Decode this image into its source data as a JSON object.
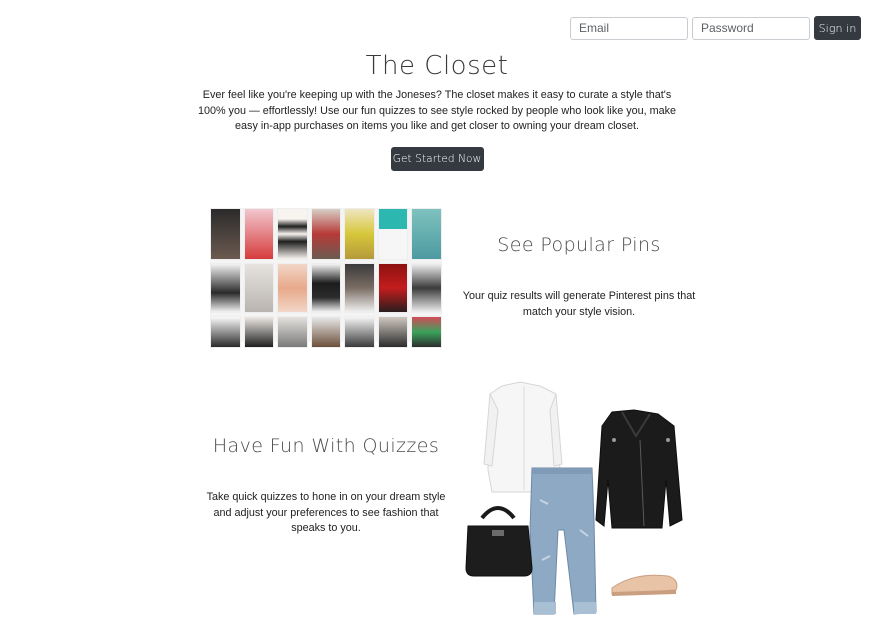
{
  "signin": {
    "email_placeholder": "Email",
    "password_placeholder": "Password",
    "button_label": "Sign in"
  },
  "hero": {
    "title": "The Closet",
    "intro": "Ever feel like you're keeping up with the Joneses? The closet makes it easy to curate a style that's 100% you — effortlessly! Use our fun quizzes to see style rocked by people who look like you, make easy in-app purchases on items you like and get closer to owning your dream closet.",
    "cta_label": "Get Started Now"
  },
  "pins": {
    "heading": "See Popular Pins",
    "text": "Your quiz results will generate Pinterest pins that match your style vision."
  },
  "quizzes": {
    "heading": "Have Fun With Quizzes",
    "text": "Take quick quizzes to hone in on your dream style and adjust your preferences to see fashion that speaks to you."
  },
  "colors": {
    "dark_button": "#343a40",
    "heading_gray": "#4a4a4a"
  }
}
